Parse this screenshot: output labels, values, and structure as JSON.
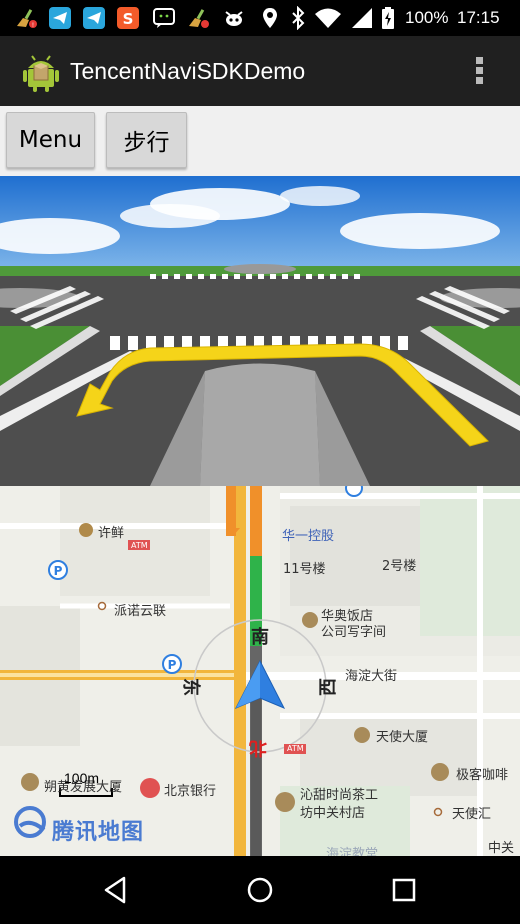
{
  "status_bar": {
    "battery": "100%",
    "time": "17:15",
    "icons": [
      "broom-icon",
      "telegram-icon",
      "telegram-icon",
      "sogou-icon",
      "chat-icon",
      "broom-icon",
      "robot-icon",
      "location-icon",
      "bluetooth-icon",
      "wifi-icon",
      "battery-icon"
    ]
  },
  "action_bar": {
    "title": "TencentNaviSDKDemo",
    "overflow": "more-vert-icon"
  },
  "toolbar": {
    "menu_label": "Menu",
    "walk_label": "步行"
  },
  "map": {
    "labels": {
      "xuxian": "许鲜",
      "atm1": "ATM",
      "huayi": "华一控股",
      "building11": "11号楼",
      "building2": "2号楼",
      "painuo": "派诺云联",
      "huaao1": "华奥饭店",
      "huaao2": "公司写字间",
      "south": "南",
      "east": "东",
      "west": "西",
      "north": "北",
      "haidian_street": "海淀大街",
      "tianshi": "天使大厦",
      "atm2": "ATM",
      "geek": "极客咖啡",
      "shuofang": "朔黄发展大厦",
      "bjbank": "北京银行",
      "qintian1": "沁甜时尚茶工",
      "qintian2": "坊中关村店",
      "tianshihui": "天使汇",
      "zhongguan": "中关",
      "haidian_edu": "海淀教堂"
    },
    "scale": "100m",
    "logo": "腾讯地图"
  },
  "colors": {
    "route_green": "#2fb34a",
    "route_orange": "#f0902a",
    "road_yellow": "#f7c534",
    "nav_arrow": "#2f7fe0"
  }
}
